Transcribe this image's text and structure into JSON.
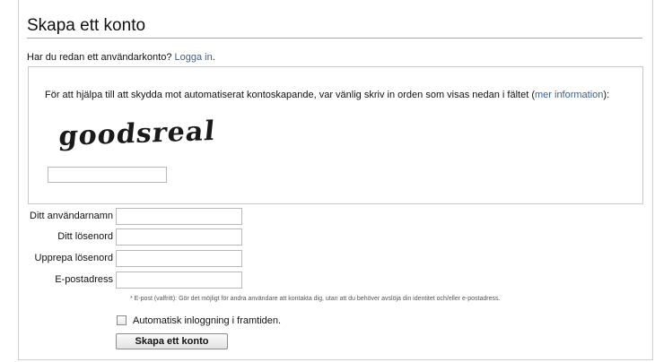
{
  "page": {
    "title": "Skapa ett konto"
  },
  "login": {
    "prompt": "Har du redan ett användarkonto?",
    "link": "Logga in"
  },
  "captcha": {
    "instruction": "För att hjälpa till att skydda mot automatiserat kontoskapande, var vänlig skriv in orden som visas nedan i fältet (",
    "more_info_link": "mer information",
    "instruction_end": "):",
    "image_text": "goodsreal",
    "input_value": ""
  },
  "fields": [
    {
      "label": "Ditt användarnamn",
      "value": ""
    },
    {
      "label": "Ditt lösenord",
      "value": ""
    },
    {
      "label": "Upprepa lösenord",
      "value": ""
    },
    {
      "label": "E-postadress",
      "value": ""
    }
  ],
  "email_note": "* E-post (valfritt): Gör det möjligt för andra användare att kontakta dig, utan att du behöver avslöja din identitet och/eller e-postadress.",
  "remember": {
    "label": "Automatisk inloggning i framtiden.",
    "checked": false
  },
  "submit": {
    "label": "Skapa ett konto"
  }
}
